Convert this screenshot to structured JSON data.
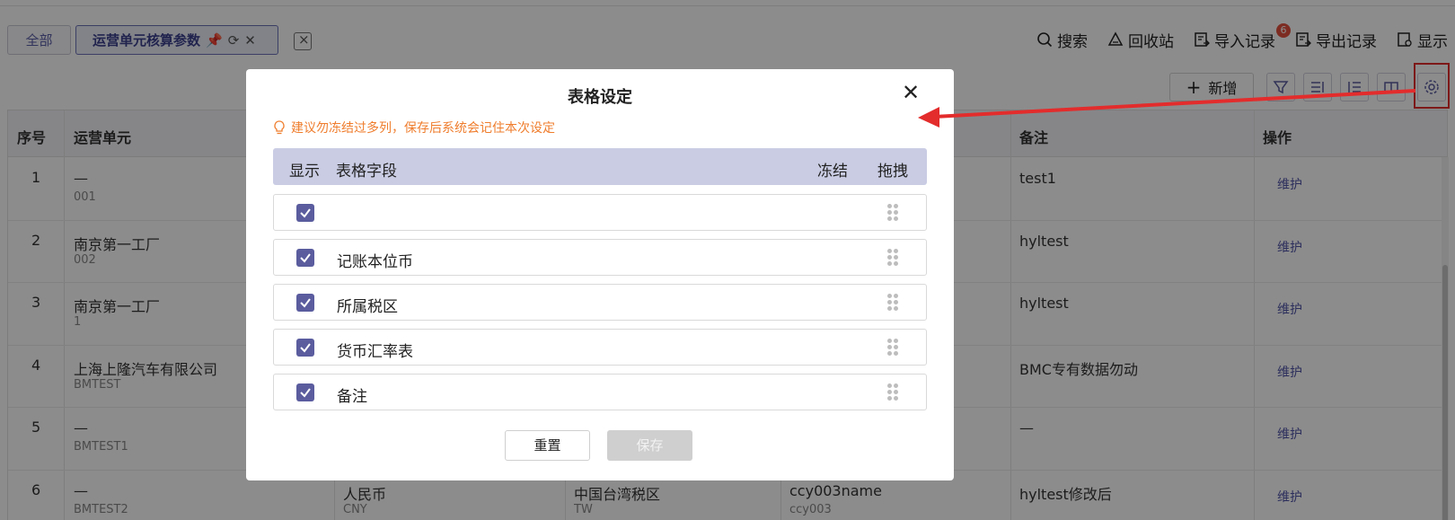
{
  "tabs": {
    "all_label": "全部",
    "active_label": "运营单元核算参数"
  },
  "toolbar": {
    "search": "搜索",
    "recycle": "回收站",
    "import": "导入记录",
    "import_badge": "6",
    "export": "导出记录",
    "display": "显示"
  },
  "actions": {
    "add_label": "新增"
  },
  "table": {
    "headers": {
      "index": "序号",
      "unit": "运营单元",
      "remark": "备注",
      "operation": "操作"
    },
    "rows": [
      {
        "index": "1",
        "unit": "—",
        "unit_code": "001",
        "c2": "",
        "c2_sub": "",
        "c3": "",
        "c3_sub": "",
        "c4": "",
        "c4_sub": "",
        "remark": "test1",
        "action": "维护"
      },
      {
        "index": "2",
        "unit": "南京第一工厂",
        "unit_code": "002",
        "c2": "",
        "c2_sub": "",
        "c3": "",
        "c3_sub": "",
        "c4": "",
        "c4_sub": "",
        "remark": "hyltest",
        "action": "维护"
      },
      {
        "index": "3",
        "unit": "南京第一工厂",
        "unit_code": "1",
        "c2": "",
        "c2_sub": "",
        "c3": "",
        "c3_sub": "",
        "c4": "",
        "c4_sub": "",
        "remark": "hyltest",
        "action": "维护"
      },
      {
        "index": "4",
        "unit": "上海上隆汽车有限公司",
        "unit_code": "BMTEST",
        "c2": "",
        "c2_sub": "",
        "c3": "",
        "c3_sub": "",
        "c4": "",
        "c4_sub": "",
        "remark": "BMC专有数据勿动",
        "action": "维护"
      },
      {
        "index": "5",
        "unit": "—",
        "unit_code": "BMTEST1",
        "c2": "",
        "c2_sub": "",
        "c3": "",
        "c3_sub": "",
        "c4": "",
        "c4_sub": "",
        "remark": "—",
        "action": "维护"
      },
      {
        "index": "6",
        "unit": "—",
        "unit_code": "BMTEST2",
        "c2": "人民币",
        "c2_sub": "CNY",
        "c3": "中国台湾税区",
        "c3_sub": "TW",
        "c4": "ccy003name",
        "c4_sub": "ccy003",
        "remark": "hyltest修改后",
        "action": "维护"
      }
    ]
  },
  "modal": {
    "title": "表格设定",
    "tip": "建议勿冻结过多列，保存后系统会记住本次设定",
    "head": {
      "show": "显示",
      "field": "表格字段",
      "freeze": "冻结",
      "drag": "拖拽"
    },
    "rows": [
      {
        "label": "",
        "checked": true
      },
      {
        "label": "记账本位币",
        "checked": true
      },
      {
        "label": "所属税区",
        "checked": true
      },
      {
        "label": "货币汇率表",
        "checked": true
      },
      {
        "label": "备注",
        "checked": true
      }
    ],
    "reset_label": "重置",
    "save_label": "保存"
  },
  "colors": {
    "accent": "#5a5c9e",
    "tip": "#ef7d2d",
    "annotation": "#e32c2c"
  }
}
